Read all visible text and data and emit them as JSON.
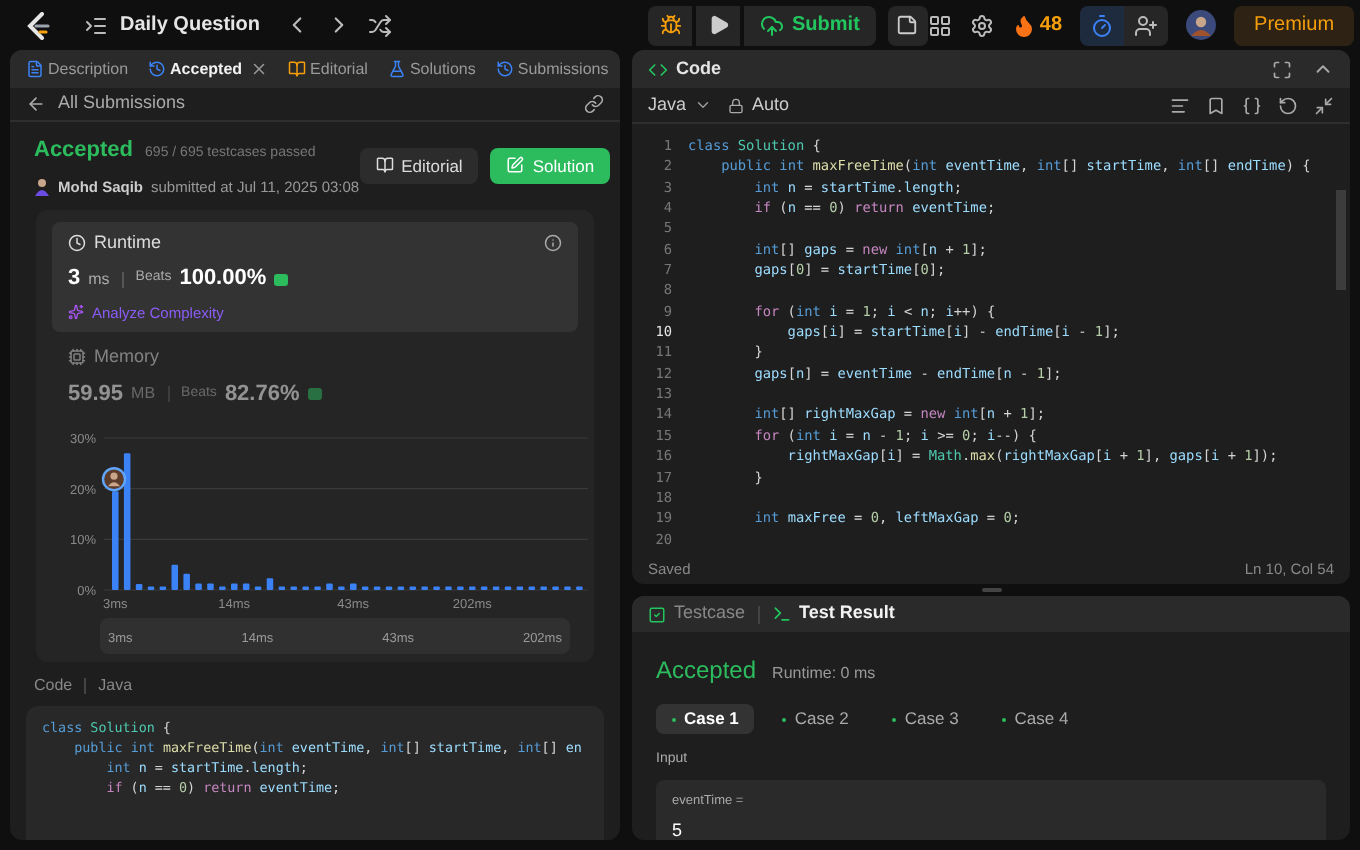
{
  "top_bar": {
    "title": "Daily Question",
    "submit": "Submit",
    "streak": "48",
    "premium": "Premium"
  },
  "left_tabs": [
    {
      "label": "Description",
      "selected": false,
      "closable": false,
      "kind": "description"
    },
    {
      "label": "Accepted",
      "selected": true,
      "closable": true,
      "kind": "history"
    },
    {
      "label": "Editorial",
      "selected": false,
      "closable": false,
      "kind": "editorial"
    },
    {
      "label": "Solutions",
      "selected": false,
      "closable": false,
      "kind": "solutions"
    },
    {
      "label": "Submissions",
      "selected": false,
      "closable": false,
      "kind": "history"
    }
  ],
  "back_link": "All Submissions",
  "submission": {
    "status": "Accepted",
    "passed": "695 / 695 testcases passed",
    "author": "Mohd Saqib",
    "submitted": "submitted at Jul 11, 2025 03:08",
    "buttons": [
      {
        "label": "Editorial",
        "kind": "secondary"
      },
      {
        "label": "Solution",
        "kind": "primary"
      }
    ]
  },
  "metrics": [
    {
      "kind": "runtime",
      "title": "Runtime",
      "value": "3",
      "unit": "ms",
      "beats_label": "Beats",
      "beats": "100.00%",
      "selected": true,
      "link": "Analyze Complexity"
    },
    {
      "kind": "memory",
      "title": "Memory",
      "value": "59.95",
      "unit": "MB",
      "beats_label": "Beats",
      "beats": "82.76%",
      "selected": false
    }
  ],
  "chart_data": {
    "type": "bar",
    "yticks": [
      {
        "value": 0,
        "label": "0%"
      },
      {
        "value": 10,
        "label": "10%"
      },
      {
        "value": 20,
        "label": "20%"
      },
      {
        "value": 30,
        "label": "30%"
      }
    ],
    "ylim": [
      0,
      30
    ],
    "categories": [
      "3ms",
      null,
      null,
      null,
      null,
      null,
      null,
      null,
      null,
      null,
      "14ms",
      null,
      null,
      null,
      null,
      null,
      null,
      null,
      null,
      null,
      "43ms",
      null,
      null,
      null,
      null,
      null,
      null,
      null,
      null,
      null,
      "202ms",
      null,
      null,
      null,
      null,
      null,
      null,
      null,
      null,
      null
    ],
    "values": [
      19.5,
      27,
      1.2,
      0.7,
      0.7,
      5,
      3.2,
      1.3,
      1.3,
      0.7,
      1.3,
      1.3,
      0.7,
      2.3,
      0.7,
      0.7,
      0.7,
      0.7,
      1.3,
      0.7,
      1.3,
      0.7,
      0.7,
      0.7,
      0.7,
      0.7,
      0.7,
      0.7,
      0.7,
      0.7,
      0.7,
      0.7,
      0.7,
      0.7,
      0.7,
      0.7,
      0.7,
      0.7,
      0.7,
      0.7
    ]
  },
  "overview_labels": [
    "3ms",
    "14ms",
    "43ms",
    "202ms"
  ],
  "code_preview": {
    "label": "Code",
    "language": "Java",
    "lines": [
      "class Solution {",
      "    public int maxFreeTime(int eventTime, int[] startTime, int[] en",
      "        int n = startTime.length;",
      "        if (n == 0) return eventTime;"
    ]
  },
  "editor": {
    "title": "Code",
    "language": "Java",
    "mode": "Auto",
    "status": "Saved",
    "cursor": "Ln 10, Col 54",
    "lines": [
      {
        "number": "1",
        "text": "class Solution {",
        "active": false
      },
      {
        "number": "2",
        "text": "    public int maxFreeTime(int eventTime, int[] startTime, int[] endTime) {",
        "active": false
      },
      {
        "number": "3",
        "text": "        int n = startTime.length;",
        "active": false
      },
      {
        "number": "4",
        "text": "        if (n == 0) return eventTime;",
        "active": false
      },
      {
        "number": "5",
        "active": false
      },
      {
        "number": "6",
        "text": "        int[] gaps = new int[n + 1];",
        "active": false
      },
      {
        "number": "7",
        "text": "        gaps[0] = startTime[0];",
        "active": false
      },
      {
        "number": "8",
        "active": false
      },
      {
        "number": "9",
        "text": "        for (int i = 1; i < n; i++) {",
        "active": false
      },
      {
        "number": "10",
        "text": "            gaps[i] = startTime[i] - endTime[i - 1];",
        "active": true
      },
      {
        "number": "11",
        "text": "        }",
        "active": false
      },
      {
        "number": "12",
        "text": "        gaps[n] = eventTime - endTime[n - 1];",
        "active": false
      },
      {
        "number": "13",
        "active": false
      },
      {
        "number": "14",
        "text": "        int[] rightMaxGap = new int[n + 1];",
        "active": false
      },
      {
        "number": "15",
        "text": "        for (int i = n - 1; i >= 0; i--) {",
        "active": false
      },
      {
        "number": "16",
        "text": "            rightMaxGap[i] = Math.max(rightMaxGap[i + 1], gaps[i + 1]);",
        "active": false
      },
      {
        "number": "17",
        "text": "        }",
        "active": false
      },
      {
        "number": "18",
        "active": false
      },
      {
        "number": "19",
        "text": "        int maxFree = 0, leftMaxGap = 0;",
        "active": false
      },
      {
        "number": "20",
        "active": false
      }
    ]
  },
  "test_panel": {
    "tabs": [
      {
        "label": "Testcase",
        "selected": false,
        "kind": "testcase"
      },
      {
        "label": "Test Result",
        "selected": true,
        "kind": "result"
      }
    ],
    "status": "Accepted",
    "runtime": "Runtime: 0 ms",
    "cases": [
      {
        "label": "Case 1",
        "selected": true
      },
      {
        "label": "Case 2",
        "selected": false
      },
      {
        "label": "Case 3",
        "selected": false
      },
      {
        "label": "Case 4",
        "selected": false
      }
    ],
    "input_label": "Input",
    "params": [
      {
        "name": "eventTime =",
        "value": "5"
      }
    ]
  }
}
